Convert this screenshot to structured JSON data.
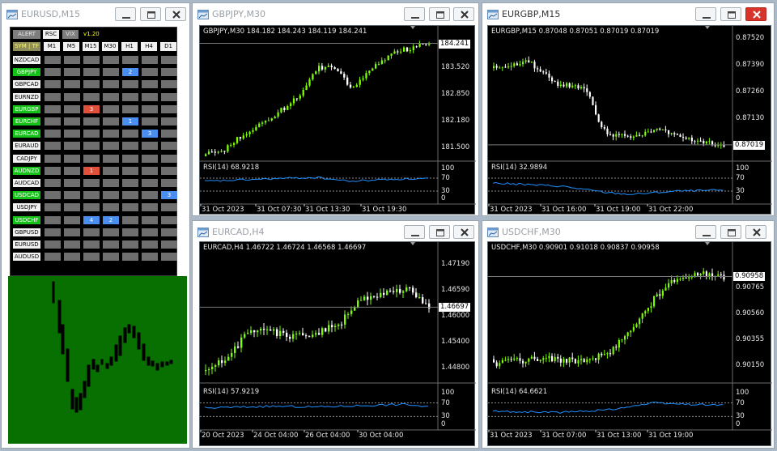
{
  "windows": [
    {
      "id": "eurusd",
      "title": "EURUSD,M15",
      "close_style": "plain"
    },
    {
      "id": "gbpjpy",
      "title": "GBPJPY,M30",
      "close_style": "plain"
    },
    {
      "id": "eurgbp",
      "title": "EURGBP,M15",
      "close_style": "red"
    },
    {
      "id": "eurcad",
      "title": "EURCAD,H4",
      "close_style": "plain"
    },
    {
      "id": "usdchf",
      "title": "USDCHF,M30",
      "close_style": "plain"
    }
  ],
  "dashboard": {
    "buttons": {
      "alert": "ALERT",
      "rsc": "RSC",
      "vix": "VIX",
      "sym_tf": "SYM | TF",
      "version": "v1.20"
    },
    "timeframes": [
      "M1",
      "M5",
      "M15",
      "M30",
      "H1",
      "H4",
      "D1"
    ],
    "pairs": [
      {
        "name": "NZDCAD",
        "green": false
      },
      {
        "name": "GBPJPY",
        "green": true
      },
      {
        "name": "GBPCAD",
        "green": false
      },
      {
        "name": "EURNZD",
        "green": false
      },
      {
        "name": "EURGBP",
        "green": true
      },
      {
        "name": "EURCHF",
        "green": true
      },
      {
        "name": "EURCAD",
        "green": true
      },
      {
        "name": "EURAUD",
        "green": false
      },
      {
        "name": "CADJPY",
        "green": false
      },
      {
        "name": "AUDNZD",
        "green": true
      },
      {
        "name": "AUDCAD",
        "green": false
      },
      {
        "name": "USDCAD",
        "green": true
      },
      {
        "name": "USDJPY",
        "green": false
      },
      {
        "name": "USDCHF",
        "green": true
      },
      {
        "name": "GBPUSD",
        "green": false
      },
      {
        "name": "EURUSD",
        "green": false
      },
      {
        "name": "AUDUSD",
        "green": false
      }
    ],
    "signals": [
      {
        "row": 1,
        "col": 4,
        "value": "2",
        "color": "blue"
      },
      {
        "row": 4,
        "col": 2,
        "value": "3",
        "color": "red"
      },
      {
        "row": 5,
        "col": 4,
        "value": "1",
        "color": "blue"
      },
      {
        "row": 6,
        "col": 5,
        "value": "3",
        "color": "blue"
      },
      {
        "row": 9,
        "col": 2,
        "value": "1",
        "color": "red"
      },
      {
        "row": 11,
        "col": 6,
        "value": "3",
        "color": "blue"
      },
      {
        "row": 13,
        "col": 2,
        "value": "4",
        "color": "blue"
      },
      {
        "row": 13,
        "col": 3,
        "value": "2",
        "color": "blue"
      }
    ]
  },
  "charts": {
    "gbpjpy": {
      "ohlc": "GBPJPY,M30  184.182 184.243 184.119 184.241",
      "rsi": "RSI(14) 68.9218",
      "price_ticks": [
        "183.520",
        "182.850",
        "182.180",
        "181.500"
      ],
      "current_price": "184.241",
      "rsi_ticks": [
        "100",
        "70",
        "30",
        "0"
      ],
      "time_ticks": [
        "31 Oct 2023",
        "31 Oct 07:30",
        "31 Oct 13:30",
        "31 Oct 19:30"
      ]
    },
    "eurgbp": {
      "ohlc": "EURGBP,M15  0.87048 0.87051 0.87019 0.87019",
      "rsi": "RSI(14) 32.9894",
      "price_ticks": [
        "0.87520",
        "0.87390",
        "0.87260",
        "0.87130",
        "0.87000"
      ],
      "current_price": "0.87019",
      "rsi_ticks": [
        "100",
        "70",
        "30",
        "0"
      ],
      "time_ticks": [
        "31 Oct 2023",
        "31 Oct 16:00",
        "31 Oct 19:00",
        "31 Oct 22:00"
      ]
    },
    "eurcad": {
      "ohlc": "EURCAD,H4  1.46722 1.46724 1.46568 1.46697",
      "rsi": "RSI(14) 57.9219",
      "price_ticks": [
        "1.47190",
        "1.46590",
        "1.46000",
        "1.45400",
        "1.44800"
      ],
      "current_price": "1.46697",
      "rsi_ticks": [
        "100",
        "70",
        "30",
        "0"
      ],
      "time_ticks": [
        "20 Oct 2023",
        "24 Oct 04:00",
        "26 Oct 04:00",
        "30 Oct 04:00"
      ]
    },
    "usdchf": {
      "ohlc": "USDCHF,M30  0.90901 0.91018 0.90837 0.90958",
      "rsi": "RSI(14) 64.6621",
      "price_ticks": [
        "0.90765",
        "0.90560",
        "0.90355",
        "0.90150"
      ],
      "current_price": "0.90958",
      "rsi_ticks": [
        "100",
        "70",
        "30",
        "0"
      ],
      "time_ticks": [
        "31 Oct 2023",
        "31 Oct 07:00",
        "31 Oct 13:00",
        "31 Oct 19:00"
      ]
    }
  },
  "colors": {
    "bull_candle": "#7cfc00",
    "bear_candle": "#ffffff",
    "rsi_line": "#1e90ff",
    "chart_bg": "#000000",
    "dashboard_green": "#087000",
    "pair_green": "#16c11a",
    "signal_red": "#e0503a",
    "signal_blue": "#4a8ef0"
  }
}
